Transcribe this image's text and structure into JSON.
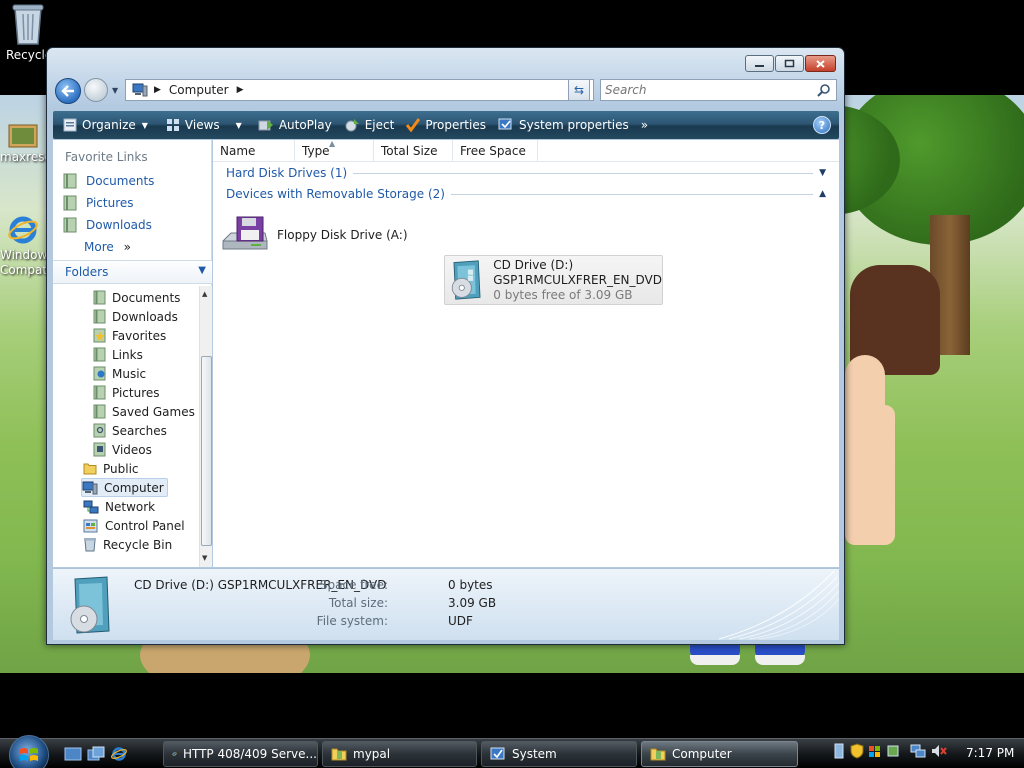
{
  "desktop": {
    "icons": [
      {
        "label": "Recycle Bin"
      },
      {
        "label": "maxresdefault"
      },
      {
        "label": "Windows Compatibility"
      }
    ]
  },
  "window": {
    "address": {
      "crumb": "Computer"
    },
    "search": {
      "placeholder": "Search"
    },
    "commands": [
      {
        "label": "Organize",
        "icon": "organize-icon"
      },
      {
        "label": "Views",
        "icon": "views-icon"
      },
      {
        "label": "AutoPlay",
        "icon": "autoplay-icon"
      },
      {
        "label": "Eject",
        "icon": "eject-icon"
      },
      {
        "label": "Properties",
        "icon": "properties-icon"
      },
      {
        "label": "System properties",
        "icon": "system-properties-icon"
      }
    ],
    "more_commands": "»",
    "help": "?",
    "nav": {
      "favorite_links_title": "Favorite Links",
      "favorites": [
        {
          "label": "Documents"
        },
        {
          "label": "Pictures"
        },
        {
          "label": "Downloads"
        }
      ],
      "more": "More",
      "more_arrows": "»",
      "folders_label": "Folders",
      "tree": [
        {
          "label": "Documents"
        },
        {
          "label": "Downloads"
        },
        {
          "label": "Favorites"
        },
        {
          "label": "Links"
        },
        {
          "label": "Music"
        },
        {
          "label": "Pictures"
        },
        {
          "label": "Saved Games"
        },
        {
          "label": "Searches"
        },
        {
          "label": "Videos"
        },
        {
          "label": "Public"
        },
        {
          "label": "Computer"
        },
        {
          "label": "Network"
        },
        {
          "label": "Control Panel"
        },
        {
          "label": "Recycle Bin"
        }
      ]
    },
    "columns": [
      {
        "label": "Name"
      },
      {
        "label": "Type"
      },
      {
        "label": "Total Size"
      },
      {
        "label": "Free Space"
      }
    ],
    "groups": [
      {
        "label": "Hard Disk Drives (1)"
      },
      {
        "label": "Devices with Removable Storage (2)"
      }
    ],
    "devices": [
      {
        "name": "Floppy Disk Drive (A:)"
      },
      {
        "name": "CD Drive (D:)",
        "label": "GSP1RMCULXFRER_EN_DVD",
        "free": "0 bytes free of 3.09 GB"
      }
    ],
    "details": {
      "title": "CD Drive (D:) GSP1RMCULXFRER_EN_DVD",
      "space_free_key": "Space free:",
      "space_free_val": "0 bytes",
      "total_size_key": "Total size:",
      "total_size_val": "3.09 GB",
      "file_system_key": "File system:",
      "file_system_val": "UDF"
    }
  },
  "taskbar": {
    "tasks": [
      {
        "label": "HTTP 408/409 Serve..."
      },
      {
        "label": "mypal"
      },
      {
        "label": "System"
      },
      {
        "label": "Computer"
      }
    ],
    "clock": "7:17 PM"
  },
  "colors": {
    "link": "#1f5aa8",
    "commandbar": "#2d5674",
    "taskbar": "#15191c"
  }
}
